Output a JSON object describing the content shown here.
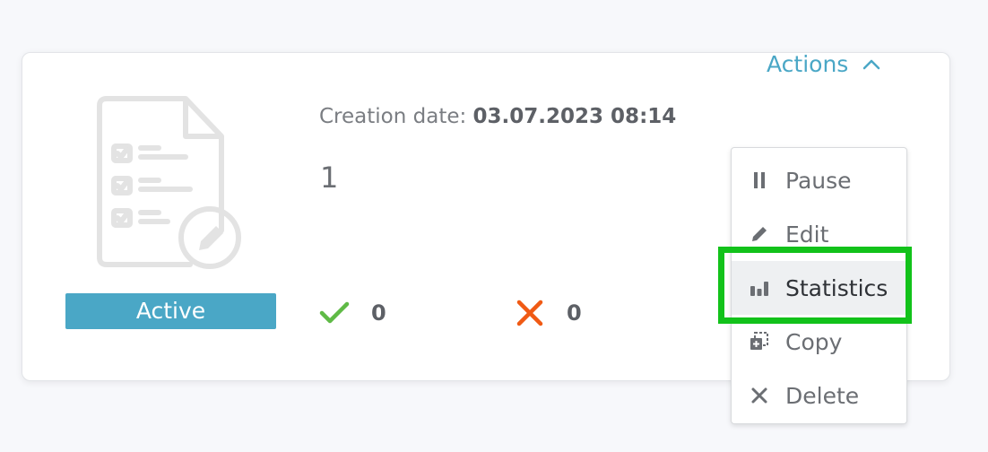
{
  "card": {
    "status_label": "Active",
    "creation_label": "Creation date:",
    "creation_value": "03.07.2023 08:14",
    "count": "1",
    "success_count": "0",
    "failure_count": "0"
  },
  "actions": {
    "toggle_label": "Actions",
    "items": [
      {
        "label": "Pause",
        "icon": "pause-icon"
      },
      {
        "label": "Edit",
        "icon": "pencil-icon"
      },
      {
        "label": "Statistics",
        "icon": "bar-chart-icon"
      },
      {
        "label": "Copy",
        "icon": "copy-icon"
      },
      {
        "label": "Delete",
        "icon": "close-icon"
      }
    ]
  },
  "colors": {
    "accent": "#4aa7c6",
    "success": "#5fba46",
    "failure": "#f05a14",
    "highlight_border": "#12c21a"
  }
}
